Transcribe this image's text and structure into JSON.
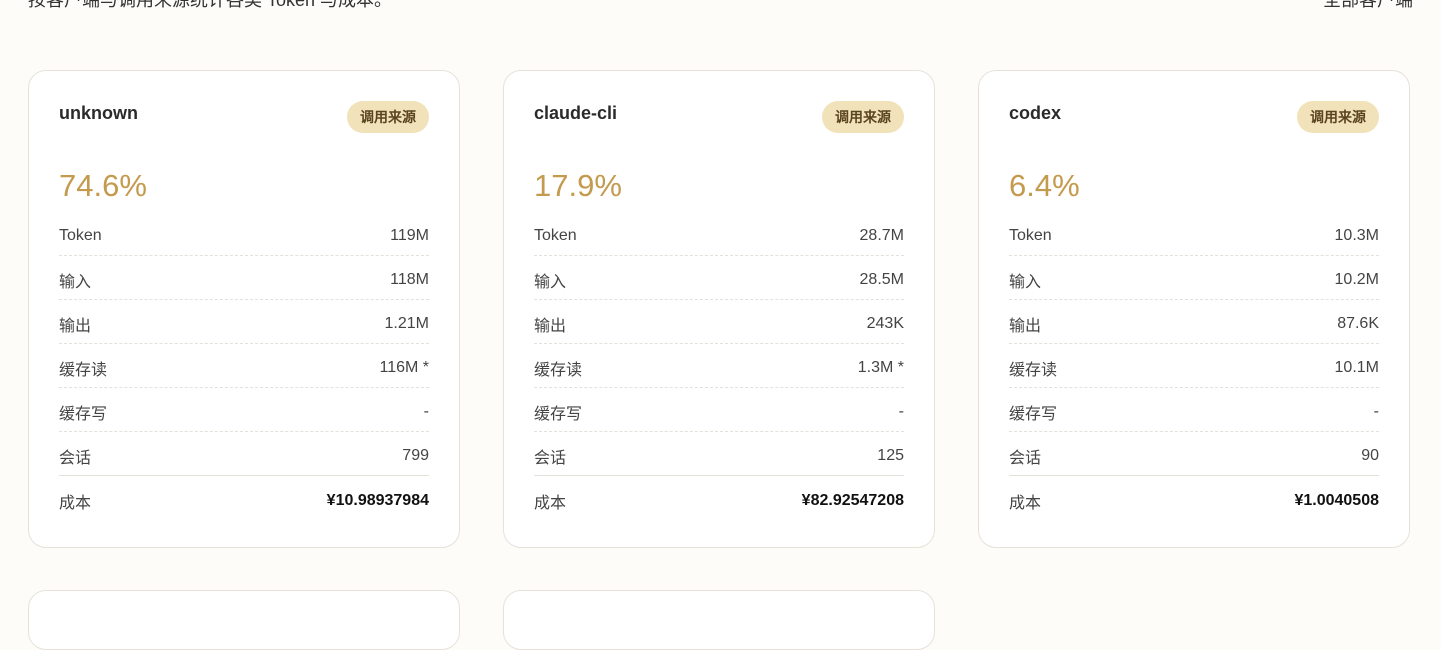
{
  "header": {
    "note": "按客户端与调用来源统计各类 Token 与成本。",
    "filter": "全部客户端"
  },
  "labels": {
    "token": "Token",
    "input": "输入",
    "output": "输出",
    "cache_read": "缓存读",
    "cache_write": "缓存写",
    "sessions": "会话",
    "cost": "成本"
  },
  "cards": [
    {
      "name": "unknown",
      "badge": "调用来源",
      "percent": "74.6%",
      "token": "119M",
      "input": "118M",
      "output": "1.21M",
      "cache_read": "116M *",
      "cache_write": "-",
      "sessions": "799",
      "cost": "¥10.98937984"
    },
    {
      "name": "claude-cli",
      "badge": "调用来源",
      "percent": "17.9%",
      "token": "28.7M",
      "input": "28.5M",
      "output": "243K",
      "cache_read": "1.3M *",
      "cache_write": "-",
      "sessions": "125",
      "cost": "¥82.92547208"
    },
    {
      "name": "codex",
      "badge": "调用来源",
      "percent": "6.4%",
      "token": "10.3M",
      "input": "10.2M",
      "output": "87.6K",
      "cache_read": "10.1M",
      "cache_write": "-",
      "sessions": "90",
      "cost": "¥1.0040508"
    }
  ],
  "colors": {
    "accent": "#c49a4e",
    "badge_bg": "#f1e2b9",
    "page_bg": "#fdfcf8"
  }
}
